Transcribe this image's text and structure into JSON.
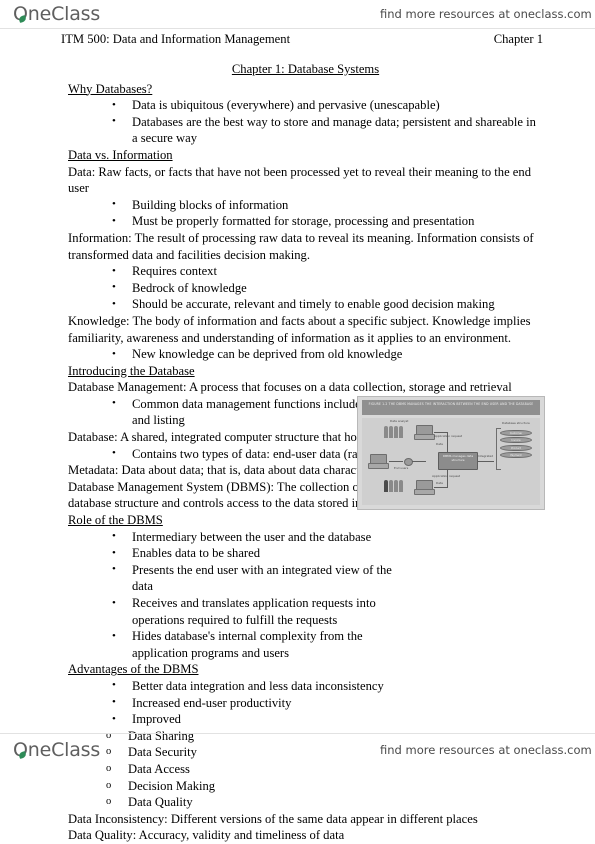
{
  "branding": {
    "logo_text": "OneClass",
    "promo_text": "find more resources at oneclass.com"
  },
  "running_head": {
    "course": "ITM 500: Data and Information Management",
    "chapter": "Chapter 1"
  },
  "document": {
    "title": "Chapter 1: Database Systems",
    "sections": [
      {
        "heading": "Why Databases?",
        "bullets": [
          "Data is ubiquitous (everywhere) and pervasive (unescapable)",
          "Databases are the best way to store and manage data; persistent and shareable in a secure way"
        ]
      },
      {
        "heading": "Data vs. Information",
        "definition_data": "Data: Raw facts, or facts that have not been processed yet to reveal their meaning to the end user",
        "data_bullets": [
          "Building blocks of information",
          "Must be properly formatted for storage, processing and presentation"
        ],
        "definition_information": "Information: The result of processing raw data to reveal its meaning. Information consists of transformed data and facilities decision making.",
        "information_bullets": [
          "Requires context",
          "Bedrock of knowledge",
          "Should be accurate, relevant and timely to enable good decision making"
        ],
        "definition_knowledge": "Knowledge: The body of information and facts about a specific subject. Knowledge implies familiarity, awareness and understanding of information as it applies to an environment.",
        "knowledge_bullets": [
          "New knowledge can be deprived from old knowledge"
        ]
      },
      {
        "heading": "Introducing the Database",
        "definition_db_management": "Database Management: A process that focuses on a data collection, storage and retrieval",
        "db_management_bullets": [
          "Common data management functions include addition, deletion, modification and listing"
        ],
        "definition_database": "Database: A shared, integrated computer structure that houses a collection of related data",
        "database_bullets": [
          "Contains two types of data: end-user data (raw facts) and metadata"
        ],
        "definition_metadata": "Metadata: Data about data; that is, data about data characteristics and relationships",
        "definition_dbms": "Database Management System (DBMS): The collection of programs that manages the database structure and controls access to the data stored in the database"
      },
      {
        "heading": "Role of the DBMS",
        "bullets": [
          "Intermediary between the user and the database",
          "Enables data to be shared",
          "Presents the end user with an integrated view of the data",
          "Receives and translates application requests into operations required to fulfill the requests",
          "Hides database's internal complexity from the application programs and users"
        ]
      },
      {
        "heading": "Advantages of the DBMS",
        "bullets": [
          "Better data integration and less data inconsistency",
          "Increased end-user productivity",
          "Improved"
        ],
        "sub_bullets": [
          "Data Sharing",
          "Data Security",
          "Data Access",
          "Decision Making",
          "Data Quality"
        ],
        "closing_lines": [
          "Data Inconsistency: Different versions of the same data appear in different places",
          "Data Quality: Accuracy, validity and timeliness of data"
        ]
      }
    ]
  },
  "figure": {
    "caption": "FIGURE 1.2  THE DBMS MANAGES THE INTERACTION BETWEEN THE END USER AND THE DATABASE",
    "labels": {
      "end_users_top": "End users",
      "end_users_bottom": "End users",
      "data_analyst": "Data analyst",
      "application_request_top": "Application request",
      "data_top": "Data",
      "application_request_bottom": "Application request",
      "data_bottom": "Data",
      "integrated": "Integrated",
      "dbms_box": "DBMS manages data structure",
      "database_structure": "Database structure"
    },
    "db_discs": [
      "Customer",
      "Invoice",
      "Product",
      "Payment"
    ],
    "accent_color": "#8f8f8f"
  }
}
